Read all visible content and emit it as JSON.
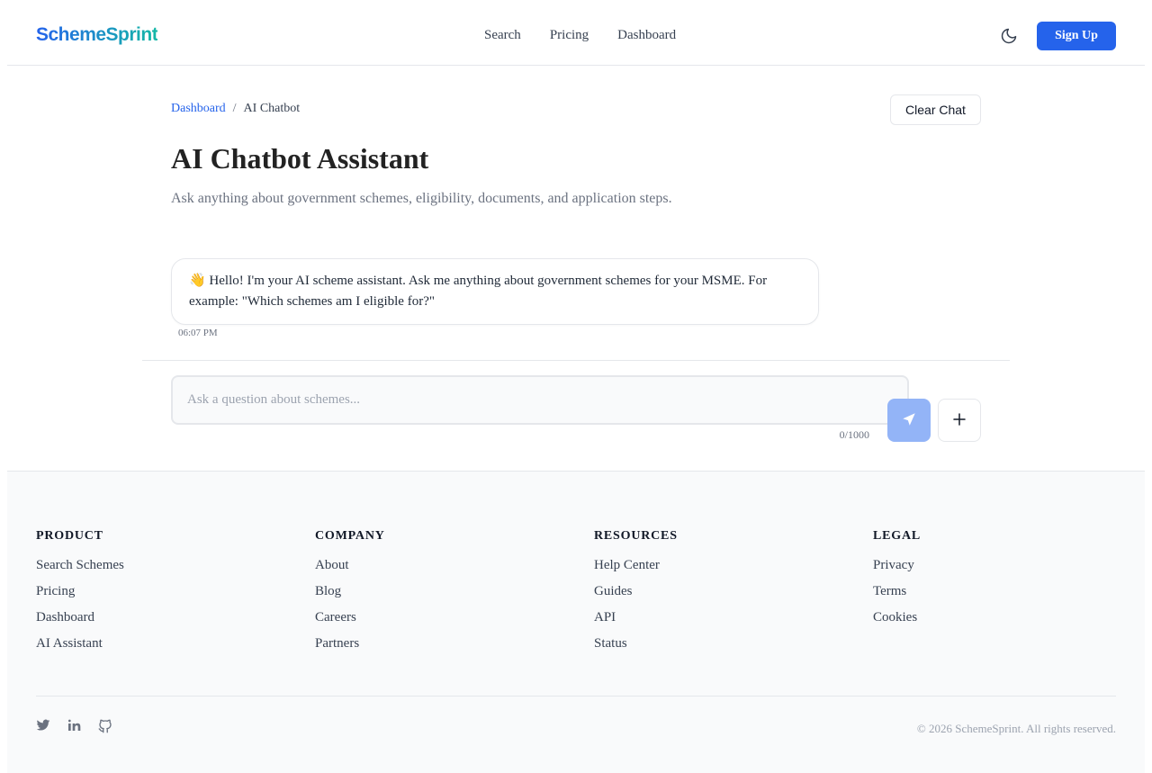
{
  "header": {
    "logo": "SchemeSprint",
    "nav": [
      "Search",
      "Pricing",
      "Dashboard"
    ],
    "theme_icon": "moon-icon",
    "signup_label": "Sign Up"
  },
  "breadcrumb": {
    "parent": "Dashboard",
    "separator": "/",
    "current": "AI Chatbot"
  },
  "page": {
    "clear_label": "Clear Chat",
    "title": "AI Chatbot Assistant",
    "subtitle": "Ask anything about government schemes, eligibility, documents, and application steps."
  },
  "chat": {
    "messages": [
      {
        "role": "assistant",
        "text": "👋 Hello! I'm your AI scheme assistant. Ask me anything about government schemes for your MSME. For example: \"Which schemes am I eligible for?\"",
        "time": "06:07 PM"
      }
    ],
    "input_placeholder": "Ask a question about schemes...",
    "input_value": "",
    "counter": "0/1000",
    "send_icon": "send-icon",
    "add_icon": "plus-icon"
  },
  "footer": {
    "columns": [
      {
        "title": "PRODUCT",
        "links": [
          "Search Schemes",
          "Pricing",
          "Dashboard",
          "AI Assistant"
        ]
      },
      {
        "title": "COMPANY",
        "links": [
          "About",
          "Blog",
          "Careers",
          "Partners"
        ]
      },
      {
        "title": "RESOURCES",
        "links": [
          "Help Center",
          "Guides",
          "API",
          "Status"
        ]
      },
      {
        "title": "LEGAL",
        "links": [
          "Privacy",
          "Terms",
          "Cookies"
        ]
      }
    ],
    "social_icons": [
      "twitter-icon",
      "linkedin-icon",
      "github-icon"
    ],
    "copyright": "© 2026 SchemeSprint. All rights reserved."
  },
  "colors": {
    "primary": "#2563eb",
    "brand_gradient_end": "#14b8a6",
    "send_disabled": "#93b4f7"
  }
}
